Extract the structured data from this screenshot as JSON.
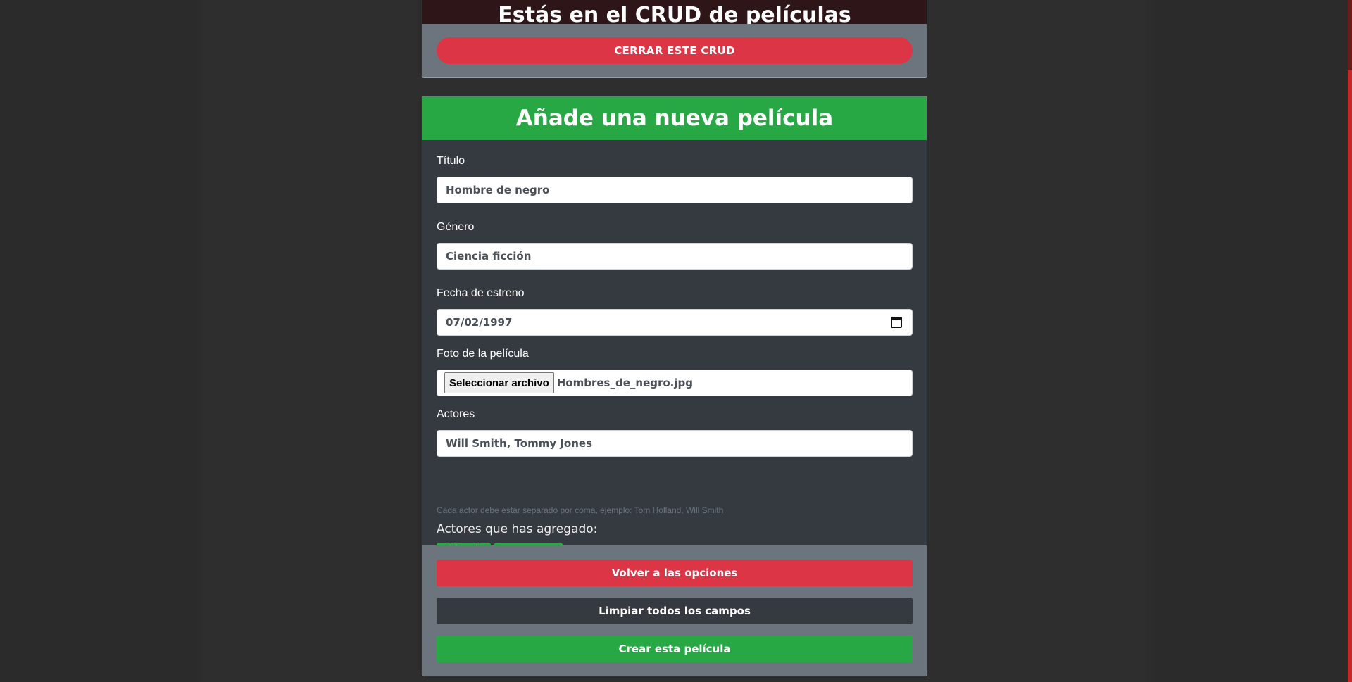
{
  "crud_header": {
    "title": "Estás en el CRUD de películas",
    "close_button": "CERRAR ESTE CRUD"
  },
  "form": {
    "title": "Añade una nueva película",
    "titulo": {
      "label": "Título",
      "value": "Hombre de negro"
    },
    "genero": {
      "label": "Género",
      "value": "Ciencia ficción"
    },
    "fecha": {
      "label": "Fecha de estreno",
      "value": "07/02/1997"
    },
    "foto": {
      "label": "Foto de la película",
      "button": "Seleccionar archivo",
      "filename": "Hombres_de_negro.jpg"
    },
    "actores": {
      "label": "Actores",
      "value": "Will Smith, Tommy Jones",
      "help": "Cada actor debe estar separado por coma, ejemplo: Tom Holland, Will Smith",
      "added_title": "Actores que has agregado:",
      "badges": [
        "Will Smith",
        "Tommy Jones"
      ]
    }
  },
  "footer": {
    "back_button": "Volver a las opciones",
    "clear_button": "Limpiar todos los campos",
    "create_button": "Crear esta película"
  }
}
